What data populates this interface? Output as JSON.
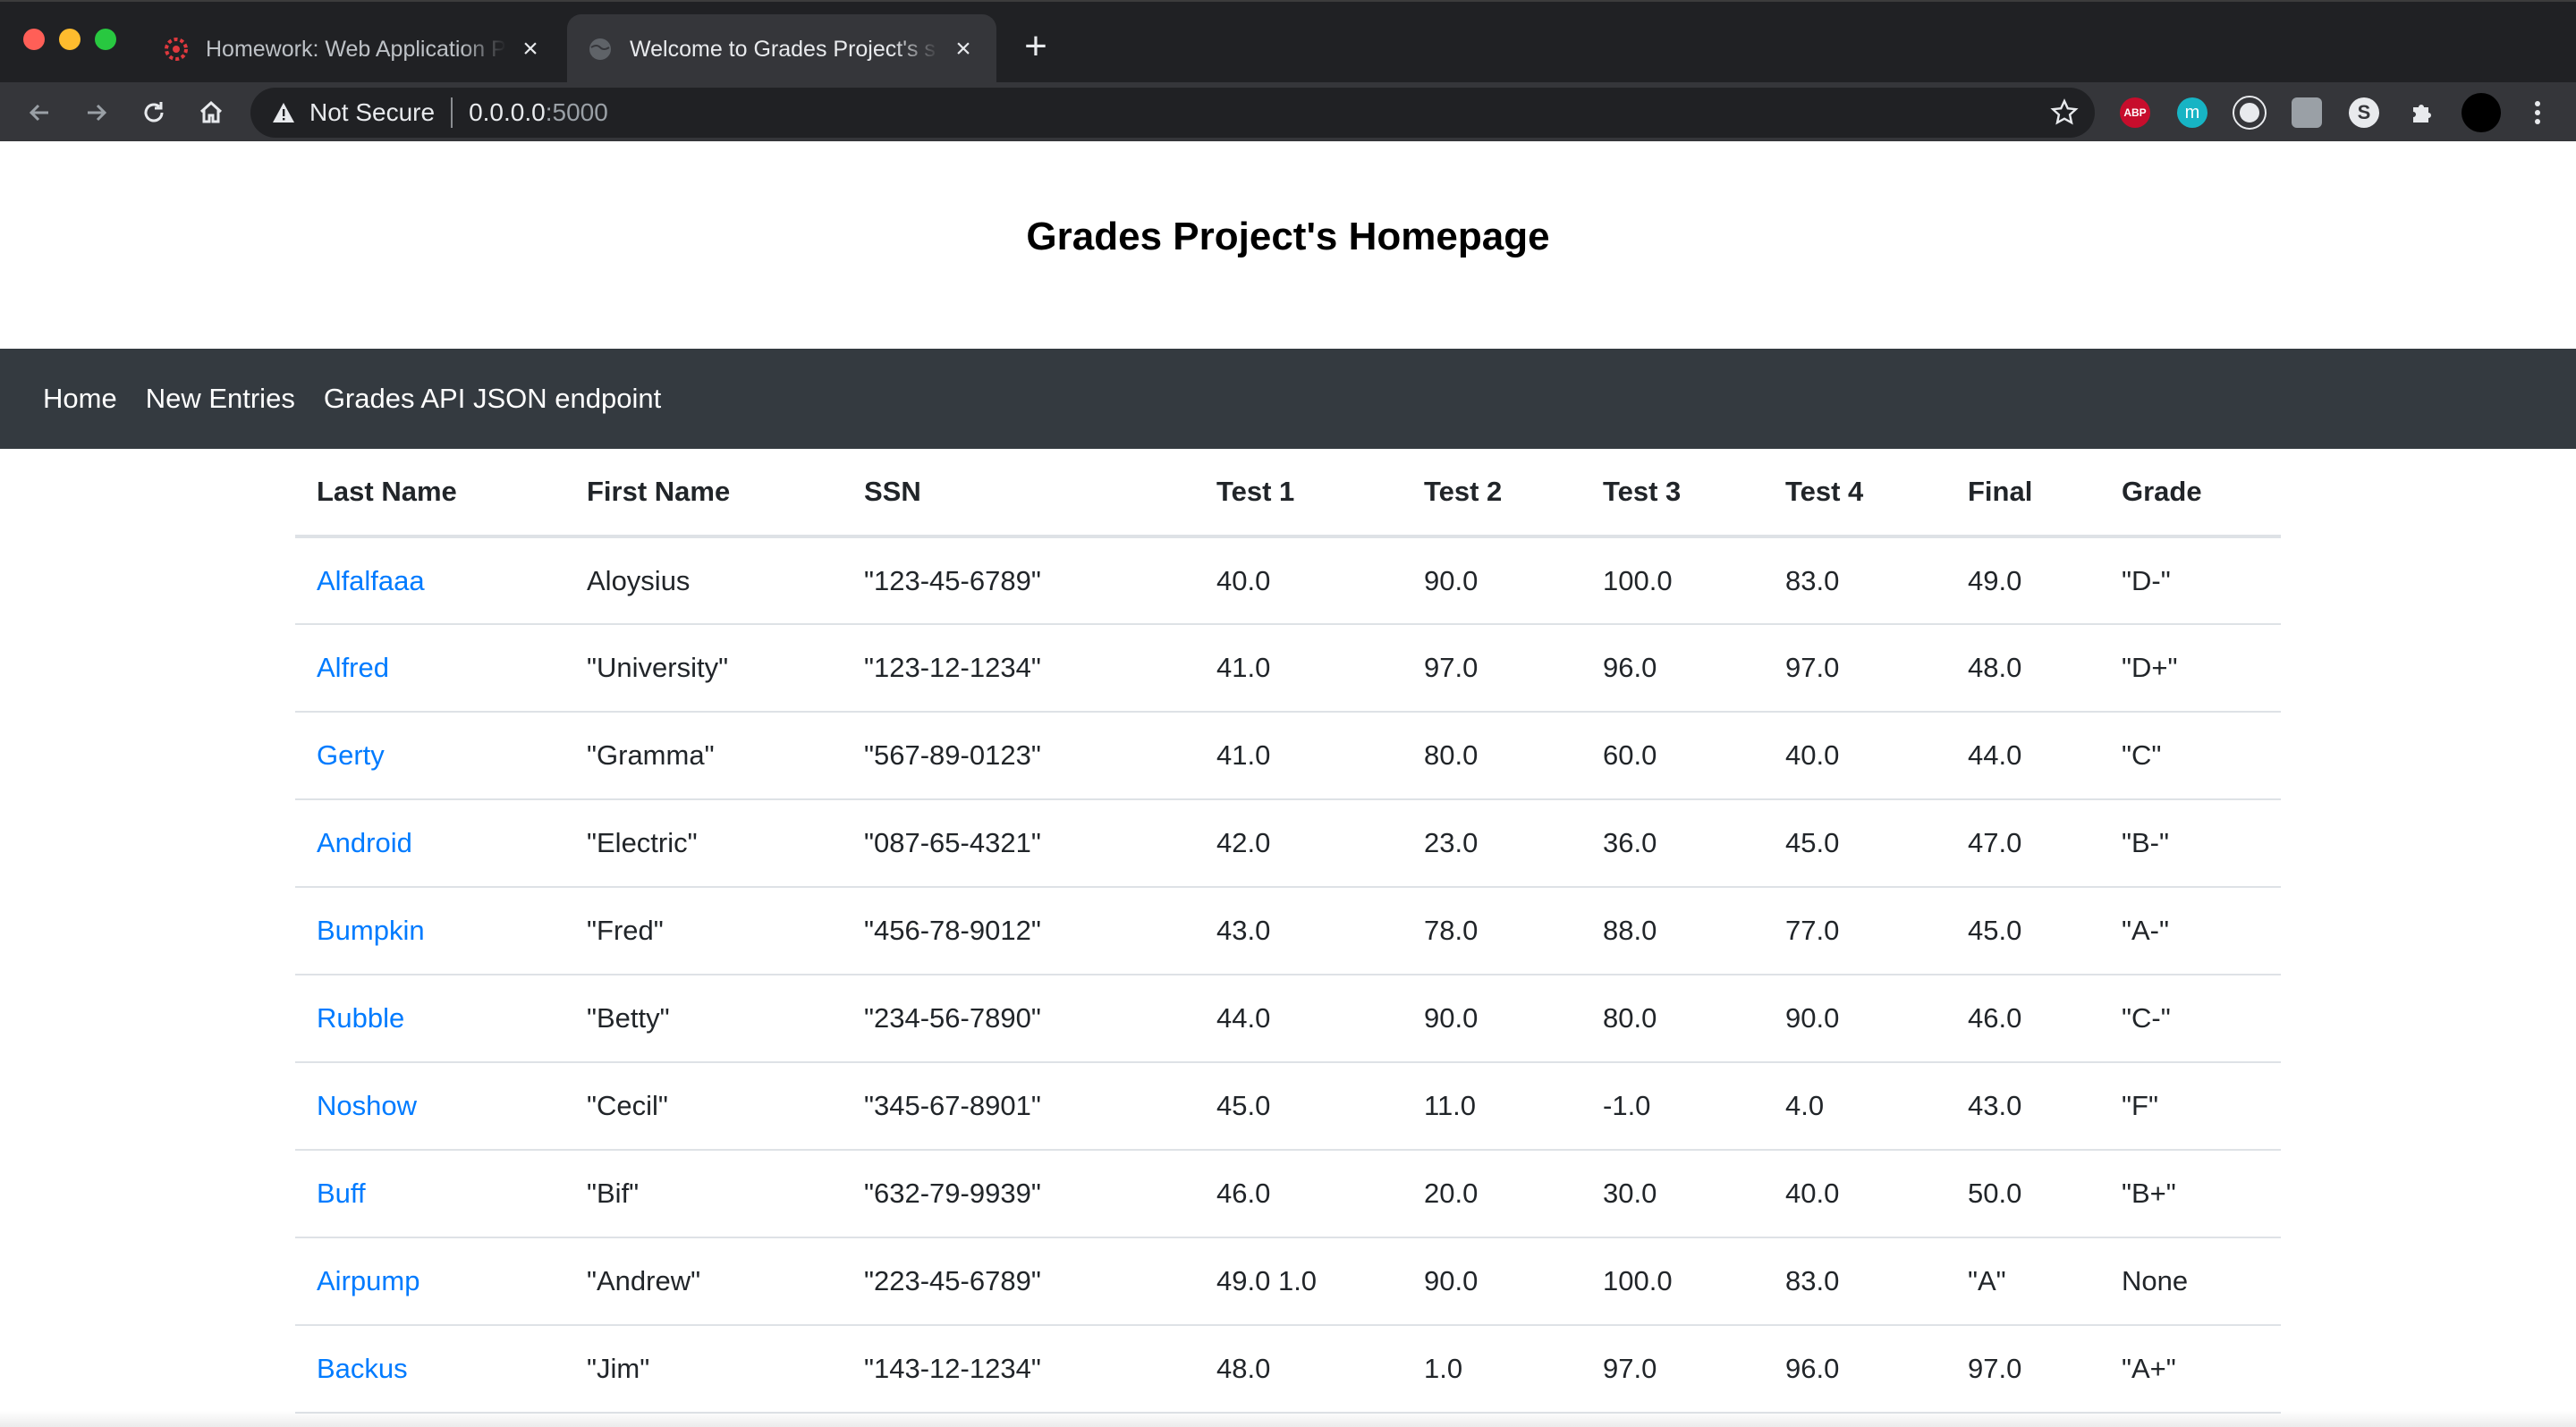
{
  "browser": {
    "tabs": [
      {
        "title": "Homework: Web Application Pa",
        "active": false,
        "favicon": "red-gear-icon"
      },
      {
        "title": "Welcome to Grades Project's s",
        "active": true,
        "favicon": "globe-icon"
      }
    ],
    "address": {
      "security_label": "Not Secure",
      "host": "0.0.0.0",
      "port": ":5000"
    },
    "extensions": [
      {
        "name": "adblock-plus-icon",
        "label": "ABP",
        "color": "#c70d2c"
      },
      {
        "name": "m-extension-icon",
        "label": "m",
        "color": "#17b4c4"
      },
      {
        "name": "circle-extension-icon",
        "label": "",
        "color": "#e8eaed"
      },
      {
        "name": "grey-extension-icon",
        "label": "",
        "color": "#9aa0a6"
      },
      {
        "name": "s-extension-icon",
        "label": "S",
        "color": "#e8eaed"
      },
      {
        "name": "puzzle-icon",
        "label": "",
        "color": "#e8eaed"
      },
      {
        "name": "profile-avatar",
        "label": "",
        "color": "#000000"
      }
    ]
  },
  "page": {
    "title": "Grades Project's Homepage",
    "nav": [
      {
        "label": "Home"
      },
      {
        "label": "New Entries"
      },
      {
        "label": "Grades API JSON endpoint"
      }
    ]
  },
  "table": {
    "headers": [
      "Last Name",
      "First Name",
      "SSN",
      "Test 1",
      "Test 2",
      "Test 3",
      "Test 4",
      "Final",
      "Grade"
    ],
    "rows": [
      [
        "Alfalfaaa",
        "Aloysius",
        "\"123-45-6789\"",
        "40.0",
        "90.0",
        "100.0",
        "83.0",
        "49.0",
        "\"D-\""
      ],
      [
        "Alfred",
        "\"University\"",
        "\"123-12-1234\"",
        "41.0",
        "97.0",
        "96.0",
        "97.0",
        "48.0",
        "\"D+\""
      ],
      [
        "Gerty",
        "\"Gramma\"",
        "\"567-89-0123\"",
        "41.0",
        "80.0",
        "60.0",
        "40.0",
        "44.0",
        "\"C\""
      ],
      [
        "Android",
        "\"Electric\"",
        "\"087-65-4321\"",
        "42.0",
        "23.0",
        "36.0",
        "45.0",
        "47.0",
        "\"B-\""
      ],
      [
        "Bumpkin",
        "\"Fred\"",
        "\"456-78-9012\"",
        "43.0",
        "78.0",
        "88.0",
        "77.0",
        "45.0",
        "\"A-\""
      ],
      [
        "Rubble",
        "\"Betty\"",
        "\"234-56-7890\"",
        "44.0",
        "90.0",
        "80.0",
        "90.0",
        "46.0",
        "\"C-\""
      ],
      [
        "Noshow",
        "\"Cecil\"",
        "\"345-67-8901\"",
        "45.0",
        "11.0",
        "-1.0",
        "4.0",
        "43.0",
        "\"F\""
      ],
      [
        "Buff",
        "\"Bif\"",
        "\"632-79-9939\"",
        "46.0",
        "20.0",
        "30.0",
        "40.0",
        "50.0",
        "\"B+\""
      ],
      [
        "Airpump",
        "\"Andrew\"",
        "\"223-45-6789\"",
        "49.0 1.0",
        "90.0",
        "100.0",
        "83.0",
        "\"A\"",
        "None"
      ],
      [
        "Backus",
        "\"Jim\"",
        "\"143-12-1234\"",
        "48.0",
        "1.0",
        "97.0",
        "96.0",
        "97.0",
        "\"A+\""
      ]
    ]
  },
  "colors": {
    "link": "#007bff",
    "navbar": "#343a40",
    "chrome_dark": "#202124",
    "chrome_toolbar": "#35363a"
  }
}
